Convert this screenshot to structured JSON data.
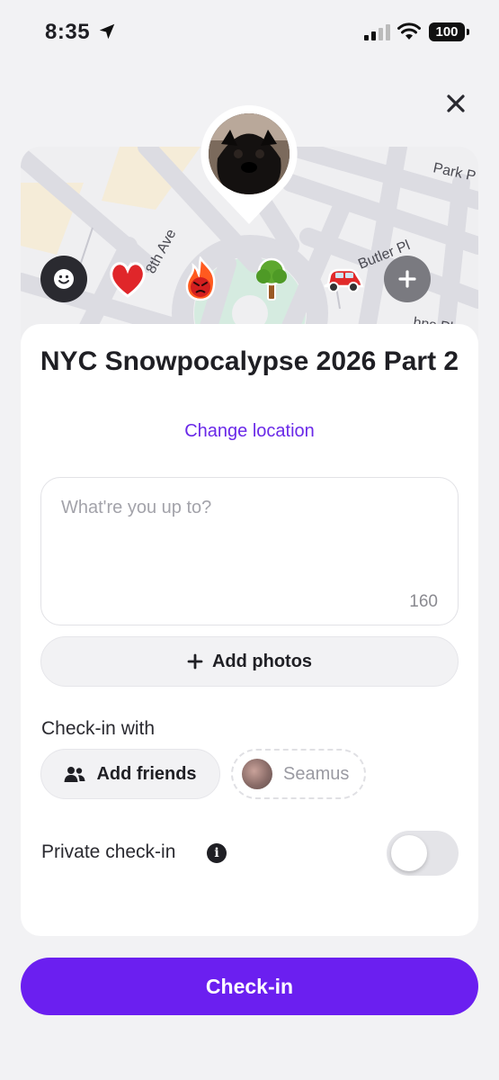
{
  "status_bar": {
    "time": "8:35",
    "battery": "100",
    "icons": [
      "location-arrow-icon",
      "cellular-signal-icon",
      "wifi-icon",
      "battery-icon"
    ]
  },
  "map": {
    "street_labels": [
      "8th Ave",
      "Park P",
      "Butler Pl",
      "hns Pl"
    ],
    "emoji_icons": [
      "smiley-face-icon",
      "red-heart-icon",
      "angry-fire-icon",
      "tree-icon",
      "red-car-icon",
      "plus-icon"
    ]
  },
  "card": {
    "title": "NYC Snowpocalypse 2026 Part 2",
    "change_location": "Change location",
    "note_placeholder": "What're you up to?",
    "char_count": "160",
    "add_photos": "Add photos",
    "checkin_with_label": "Check-in with",
    "add_friends": "Add friends",
    "friend_name": "Seamus",
    "private_label": "Private check-in",
    "private_enabled": false
  },
  "checkin_button": "Check-in",
  "colors": {
    "accent": "#6b1ff0",
    "link": "#6a29e8",
    "background": "#f2f2f4"
  }
}
